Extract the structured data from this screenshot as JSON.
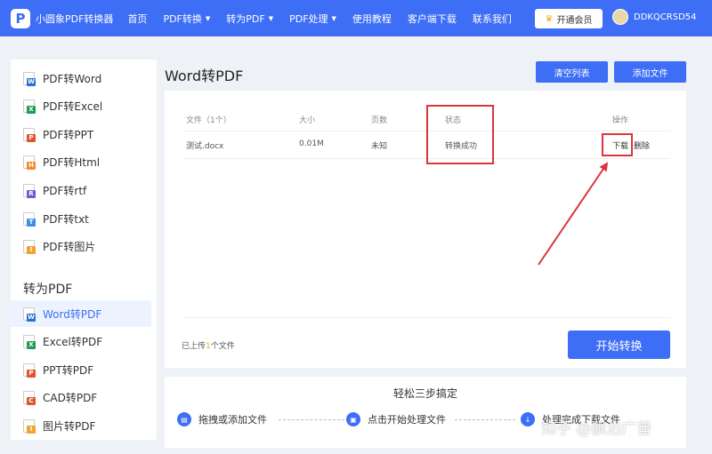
{
  "header": {
    "logo_letter": "P",
    "app_name": "小圆象PDF转换器",
    "nav": [
      {
        "label": "首页",
        "has_caret": false
      },
      {
        "label": "PDF转换",
        "has_caret": true
      },
      {
        "label": "转为PDF",
        "has_caret": true
      },
      {
        "label": "PDF处理",
        "has_caret": true
      },
      {
        "label": "使用教程",
        "has_caret": false
      },
      {
        "label": "客户端下载",
        "has_caret": false
      },
      {
        "label": "联系我们",
        "has_caret": false
      }
    ],
    "vip_label": "开通会员",
    "username": "DDKQCRSD54"
  },
  "sidebar": {
    "pdf_items": [
      {
        "label": "PDF转Word",
        "badge": "W",
        "color": "#2b6fd6"
      },
      {
        "label": "PDF转Excel",
        "badge": "X",
        "color": "#1f9d55"
      },
      {
        "label": "PDF转PPT",
        "badge": "P",
        "color": "#e0552b"
      },
      {
        "label": "PDF转Html",
        "badge": "H",
        "color": "#f08c2e"
      },
      {
        "label": "PDF转rtf",
        "badge": "R",
        "color": "#6b5bd6"
      },
      {
        "label": "PDF转txt",
        "badge": "T",
        "color": "#3a8ee6"
      },
      {
        "label": "PDF转图片",
        "badge": "I",
        "color": "#f0a32e"
      }
    ],
    "section_heading": "转为PDF",
    "to_pdf_items": [
      {
        "label": "Word转PDF",
        "badge": "W",
        "color": "#2b6fd6",
        "active": true
      },
      {
        "label": "Excel转PDF",
        "badge": "X",
        "color": "#1f9d55",
        "active": false
      },
      {
        "label": "PPT转PDF",
        "badge": "P",
        "color": "#e0552b",
        "active": false
      },
      {
        "label": "CAD转PDF",
        "badge": "C",
        "color": "#e0552b",
        "active": false
      },
      {
        "label": "图片转PDF",
        "badge": "I",
        "color": "#f0a32e",
        "active": false
      }
    ]
  },
  "main": {
    "title": "Word转PDF",
    "clear_label": "清空列表",
    "add_label": "添加文件",
    "table": {
      "headers": [
        "文件（1个）",
        "大小",
        "页数",
        "状态",
        "操作"
      ],
      "rows": [
        {
          "file": "测试.docx",
          "size": "0.01M",
          "pages": "未知",
          "status": "转换成功",
          "download": "下载",
          "delete": "删除"
        }
      ]
    },
    "uploaded_prefix": "已上传",
    "uploaded_count": "1",
    "uploaded_suffix": "个文件",
    "start_label": "开始转换"
  },
  "steps": {
    "title": "轻松三步搞定",
    "items": [
      {
        "label": "拖拽或添加文件",
        "icon": "file-icon"
      },
      {
        "label": "点击开始处理文件",
        "icon": "process-icon"
      },
      {
        "label": "处理完成下载文件",
        "icon": "download-icon"
      }
    ]
  },
  "watermark": "知乎 @飘泊广普",
  "colors": {
    "primary": "#3d6ef5",
    "highlight": "#d9363e",
    "accent": "#f5a623"
  }
}
